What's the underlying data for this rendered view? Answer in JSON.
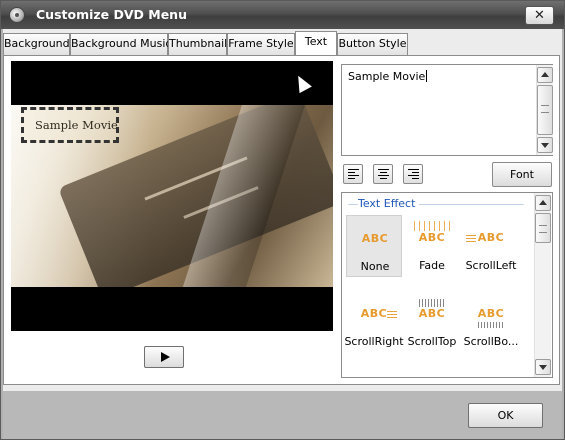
{
  "window": {
    "title": "Customize DVD Menu",
    "close_label": "✕"
  },
  "tabs": [
    {
      "label": "Background",
      "active": false
    },
    {
      "label": "Background Music",
      "active": false
    },
    {
      "label": "Thumbnail",
      "active": false
    },
    {
      "label": "Frame Style",
      "active": false
    },
    {
      "label": "Text",
      "active": true
    },
    {
      "label": "Button Style",
      "active": false
    }
  ],
  "preview": {
    "menu_title_text": "Sample Movie"
  },
  "text_input": {
    "value": "Sample Movie"
  },
  "alignment": {
    "buttons": [
      "align-left",
      "align-center",
      "align-right"
    ]
  },
  "font_button": {
    "label": "Font"
  },
  "text_effect": {
    "group_label": "Text Effect",
    "effects": [
      {
        "label": "None",
        "sample": "ABC",
        "selected": true,
        "icon": "effect-none-icon"
      },
      {
        "label": "Fade",
        "sample": "ABC",
        "selected": false,
        "icon": "effect-fade-icon"
      },
      {
        "label": "ScrollLeft",
        "sample": "ABC",
        "selected": false,
        "icon": "effect-scrollleft-icon"
      },
      {
        "label": "ScrollRight",
        "sample": "ABC",
        "selected": false,
        "icon": "effect-scrollright-icon"
      },
      {
        "label": "ScrollTop",
        "sample": "ABC",
        "selected": false,
        "icon": "effect-scrolltop-icon"
      },
      {
        "label": "ScrollBo...",
        "sample": "ABC",
        "selected": false,
        "icon": "effect-scrollbottom-icon"
      }
    ]
  },
  "footer": {
    "ok_label": "OK"
  },
  "colors": {
    "effect_text": "#e79a2d",
    "group_label": "#1d56b8",
    "title_bar": "#4f4f4f"
  }
}
